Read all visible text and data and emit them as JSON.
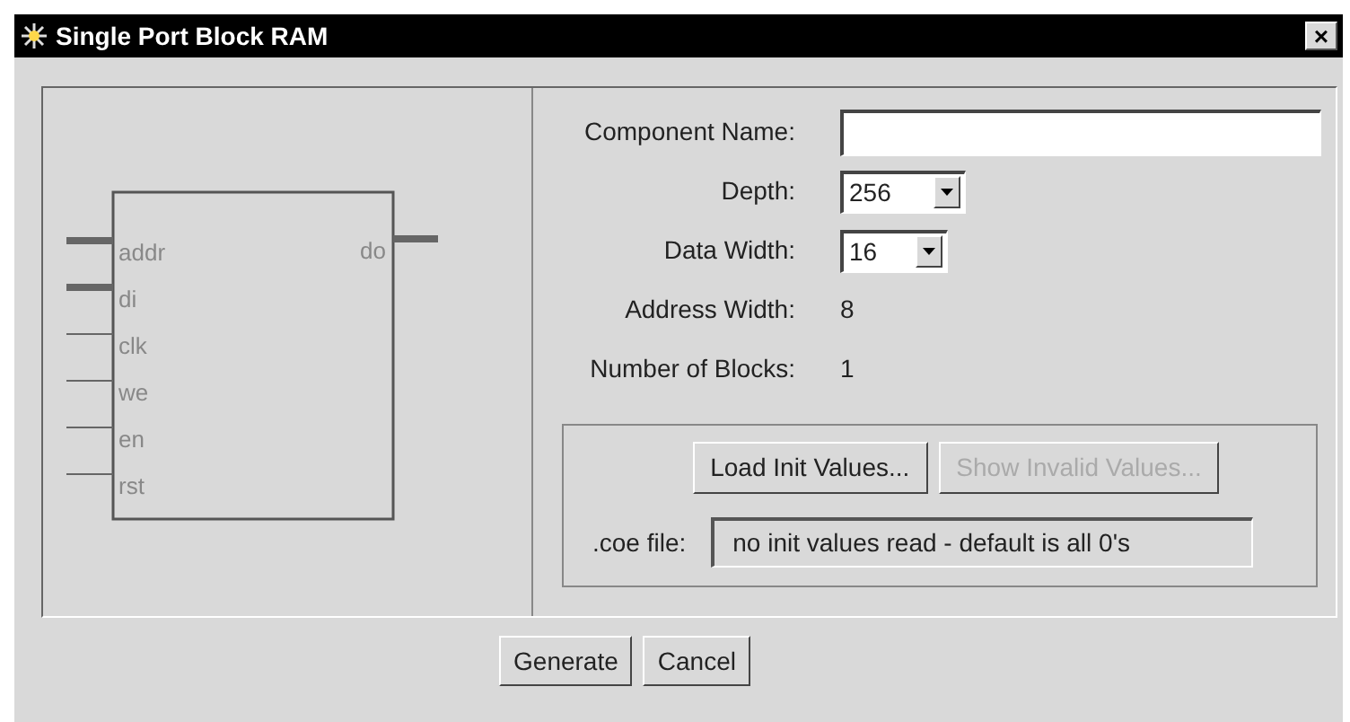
{
  "window": {
    "title": "Single Port Block RAM",
    "close": "×"
  },
  "diagram": {
    "inputs": [
      {
        "name": "addr",
        "kind": "bus"
      },
      {
        "name": "di",
        "kind": "bus"
      },
      {
        "name": "clk",
        "kind": "wire"
      },
      {
        "name": "we",
        "kind": "wire"
      },
      {
        "name": "en",
        "kind": "wire"
      },
      {
        "name": "rst",
        "kind": "wire"
      }
    ],
    "outputs": [
      {
        "name": "do",
        "kind": "bus"
      }
    ]
  },
  "form": [
    {
      "kind": "text",
      "label": "Component Name:"
    },
    {
      "kind": "select",
      "label": "Depth:",
      "value": "256"
    },
    {
      "kind": "select",
      "label": "Data Width:",
      "value": "16"
    },
    {
      "kind": "readout",
      "label": "Address Width:",
      "value": "8"
    },
    {
      "kind": "readout",
      "label": "Number of Blocks:",
      "value": "1"
    }
  ],
  "init": {
    "buttons": [
      {
        "label": "Load Init Values...",
        "disabled": false
      },
      {
        "label": "Show Invalid Values...",
        "disabled": true
      }
    ],
    "coe_label": ".coe file:",
    "coe_value": "no init values read - default is all 0's"
  },
  "buttons": [
    "Generate",
    "Cancel"
  ]
}
